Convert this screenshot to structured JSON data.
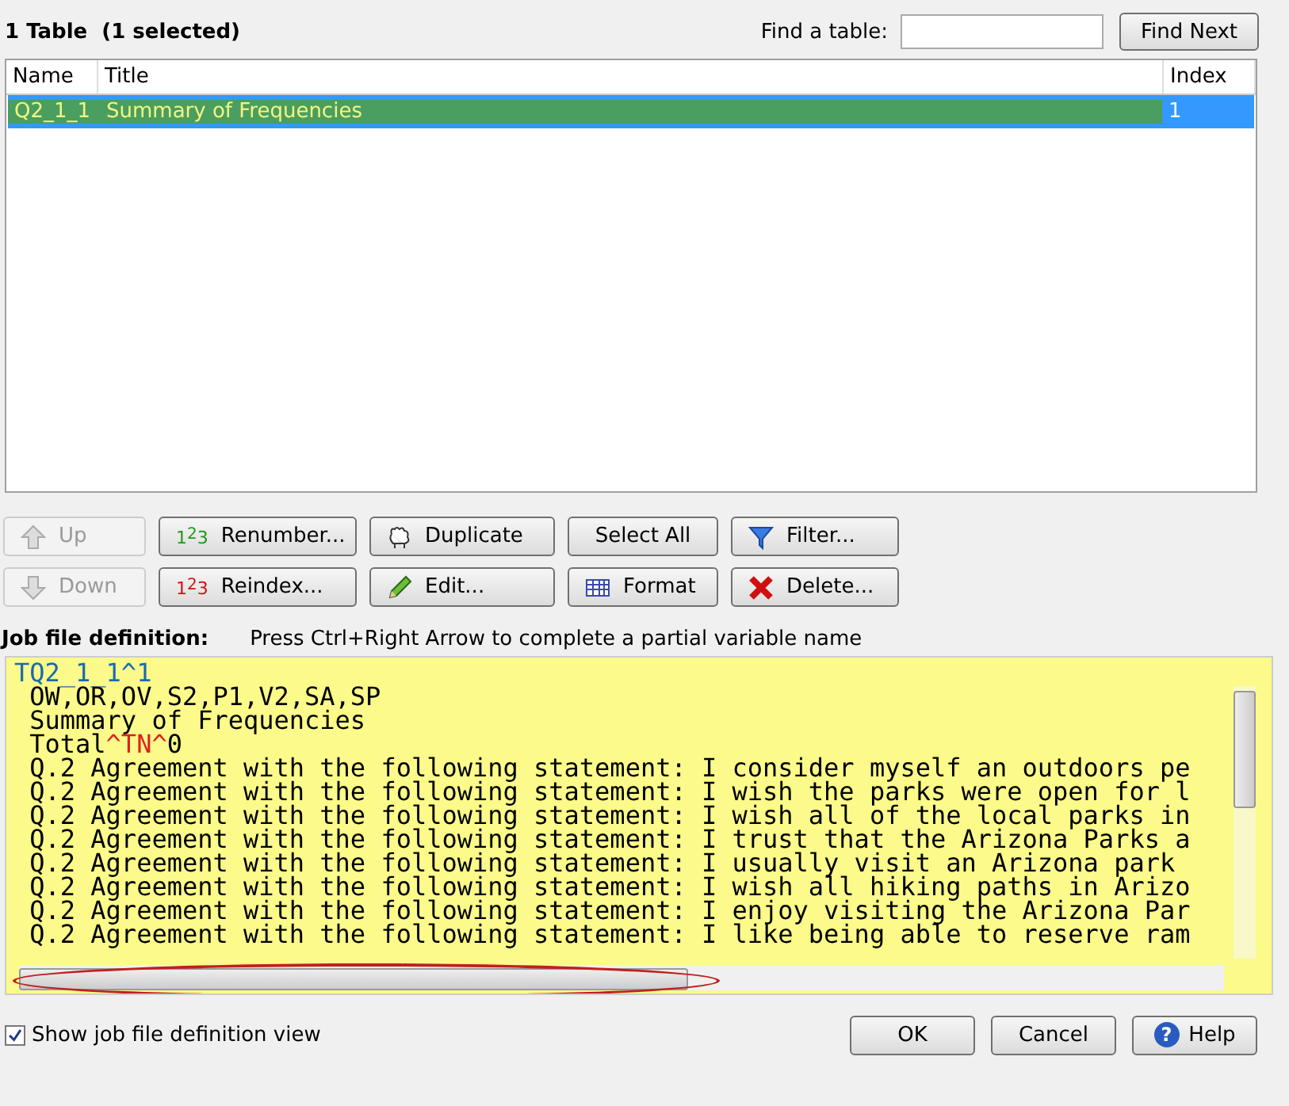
{
  "header": {
    "count_label": "1 Table  (1 selected)",
    "find_label": "Find a table:",
    "find_button": "Find Next"
  },
  "table": {
    "columns": [
      "Name",
      "Title",
      "Index"
    ],
    "rows": [
      {
        "cells": [
          "Q2_1_1",
          "Summary of Frequencies",
          "1"
        ],
        "selected": true
      }
    ]
  },
  "buttons": [
    {
      "label": "Up",
      "disabled": true
    },
    {
      "label": "Renumber...",
      "icon_text": "1$^{2}$3",
      "disabled": false
    },
    {
      "label": "Duplicate",
      "disabled": false
    },
    {
      "label": "Select All",
      "disabled": false
    },
    {
      "label": "Filter...",
      "disabled": false
    },
    {
      "label": "Down",
      "disabled": true
    },
    {
      "label": "Reindex...",
      "icon_text": "1$^{2}$3",
      "disabled": false
    },
    {
      "label": "Edit...",
      "disabled": false
    },
    {
      "label": "Format",
      "disabled": false
    },
    {
      "label": "Delete...",
      "disabled": false
    }
  ],
  "job_label": "Job file definition:",
  "job_hint": "Press Ctrl+Right Arrow to complete a partial variable name",
  "editor_lines": [
    [
      {
        "text": "TQ2_1_1^1",
        "kind": "name"
      }
    ],
    [
      {
        "text": " OW,OR,OV,S2,P1,V2,SA,SP",
        "kind": "text"
      }
    ],
    [
      {
        "text": " Summary of Frequencies",
        "kind": "text"
      }
    ],
    [
      {
        "text": " Total",
        "kind": "text"
      },
      {
        "text": "^TN^",
        "kind": "code"
      },
      {
        "text": "0",
        "kind": "text"
      }
    ],
    [
      {
        "text": " Q.2 Agreement with the following statement: I consider myself an outdoors pe",
        "kind": "text"
      }
    ],
    [
      {
        "text": " Q.2 Agreement with the following statement: I wish the parks were open for l",
        "kind": "text"
      }
    ],
    [
      {
        "text": " Q.2 Agreement with the following statement: I wish all of the local parks in",
        "kind": "text"
      }
    ],
    [
      {
        "text": " Q.2 Agreement with the following statement: I trust that the Arizona Parks a",
        "kind": "text"
      }
    ],
    [
      {
        "text": " Q.2 Agreement with the following statement: I usually visit an Arizona park",
        "kind": "text"
      }
    ],
    [
      {
        "text": " Q.2 Agreement with the following statement: I wish all hiking paths in Arizo",
        "kind": "text"
      }
    ],
    [
      {
        "text": " Q.2 Agreement with the following statement: I enjoy visiting the Arizona Par",
        "kind": "text"
      }
    ],
    [
      {
        "text": " Q.2 Agreement with the following statement: I like being able to reserve ram",
        "kind": "text"
      }
    ]
  ],
  "show_view": {
    "label": "Show job file definition view",
    "checked": true
  },
  "footer_buttons": [
    {
      "label": "OK"
    },
    {
      "label": "Cancel"
    },
    {
      "label": "Help",
      "icon_text": "?"
    }
  ]
}
